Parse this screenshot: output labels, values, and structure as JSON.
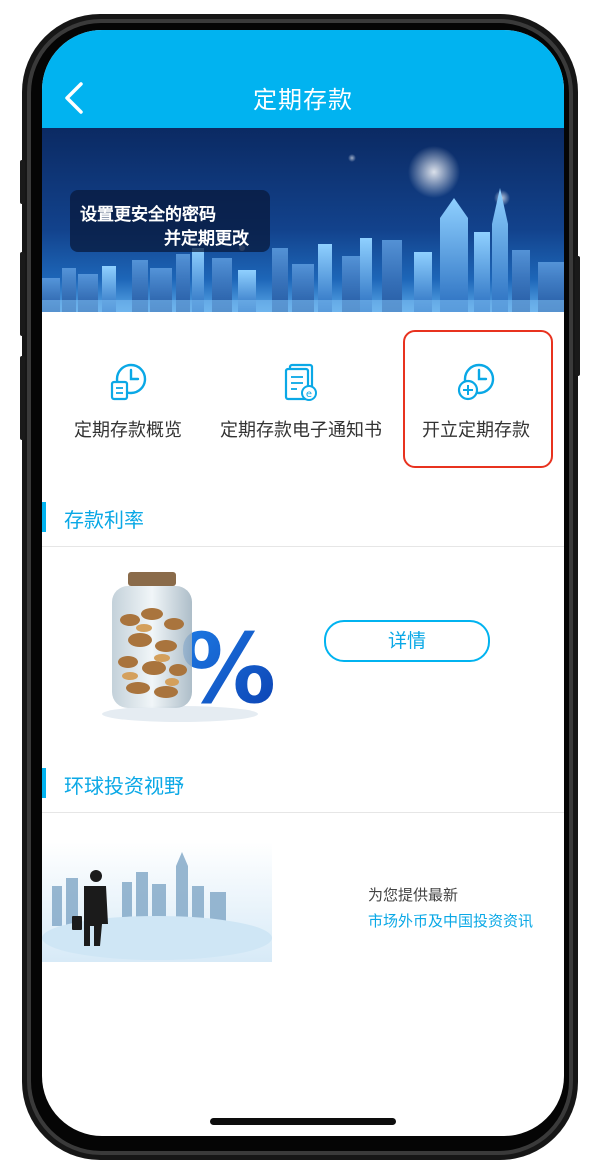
{
  "header": {
    "title": "定期存款"
  },
  "banner": {
    "caption_line1": "设置更安全的密码",
    "caption_line2": "并定期更改"
  },
  "quick_actions": [
    {
      "label": "定期存款概览",
      "icon": "clock-document-icon"
    },
    {
      "label": "定期存款电子通知书",
      "icon": "e-notice-document-icon"
    },
    {
      "label": "开立定期存款",
      "icon": "clock-plus-icon"
    }
  ],
  "sections": {
    "rates": {
      "title": "存款利率",
      "detail_button": "详情"
    },
    "global": {
      "title": "环球投资视野",
      "line1": "为您提供最新",
      "line2": "市场外币及中国投资资讯"
    }
  },
  "colors": {
    "primary": "#01b3f0",
    "highlight": "#e8321f",
    "section_title": "#0aa8e6"
  }
}
